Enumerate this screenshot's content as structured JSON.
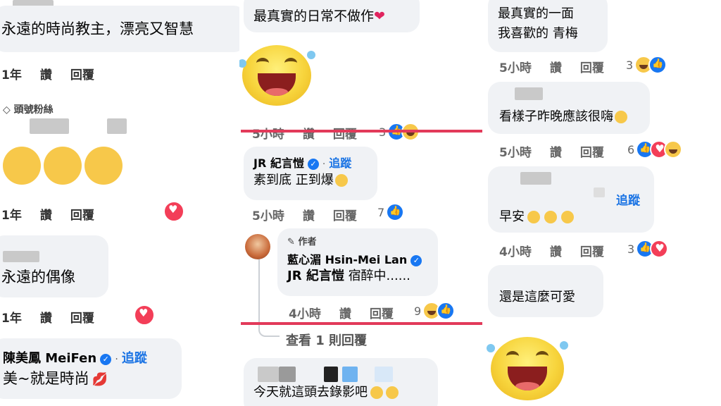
{
  "col1": {
    "c1_text": "永遠的時尚教主，漂亮又智慧",
    "c1_meta": [
      "1年",
      "讚",
      "回覆"
    ],
    "badge": "頭號粉絲",
    "c2_meta": [
      "1年",
      "讚",
      "回覆"
    ],
    "c3_text": "永遠的偶像",
    "c3_meta": [
      "1年",
      "讚",
      "回覆"
    ],
    "c4_name": "陳美鳳 MeiFen",
    "c4_follow": "追蹤",
    "c4_text": "美~就是時尚"
  },
  "col2": {
    "c1_text": "最真實的日常不做作",
    "c1_meta": [
      "5小時",
      "讚",
      "回覆"
    ],
    "c1_count": "3",
    "c2_name": "JR 紀言愷",
    "c2_follow": "追蹤",
    "c2_text": "素到底 正到爆",
    "c2_meta": [
      "5小時",
      "讚",
      "回覆"
    ],
    "c2_count": "7",
    "author_label": "作者",
    "c3_name": "藍心湄 Hsin-Mei Lan",
    "c3_text_name": "JR 紀言愷",
    "c3_text": "宿醉中......",
    "c3_meta": [
      "4小時",
      "讚",
      "回覆"
    ],
    "c3_count": "9",
    "view_replies": "查看 1 則回覆",
    "c4_text": "今天就這頭去錄影吧"
  },
  "col3": {
    "c1_line1": "最真實的一面",
    "c1_line2": "我喜歡的 青梅",
    "c1_meta": [
      "5小時",
      "讚",
      "回覆"
    ],
    "c1_count": "3",
    "c2_text": "看樣子昨晚應該很嗨",
    "c2_meta": [
      "5小時",
      "讚",
      "回覆"
    ],
    "c2_count": "6",
    "c3_follow": "追蹤",
    "c3_text": "早安",
    "c3_meta": [
      "4小時",
      "讚",
      "回覆"
    ],
    "c3_count": "3",
    "c4_text": "還是這麼可愛"
  },
  "colors": {
    "bubble": "#f0f2f5",
    "accent_blue": "#1b74e4",
    "highlight_red": "#e23a5a"
  }
}
